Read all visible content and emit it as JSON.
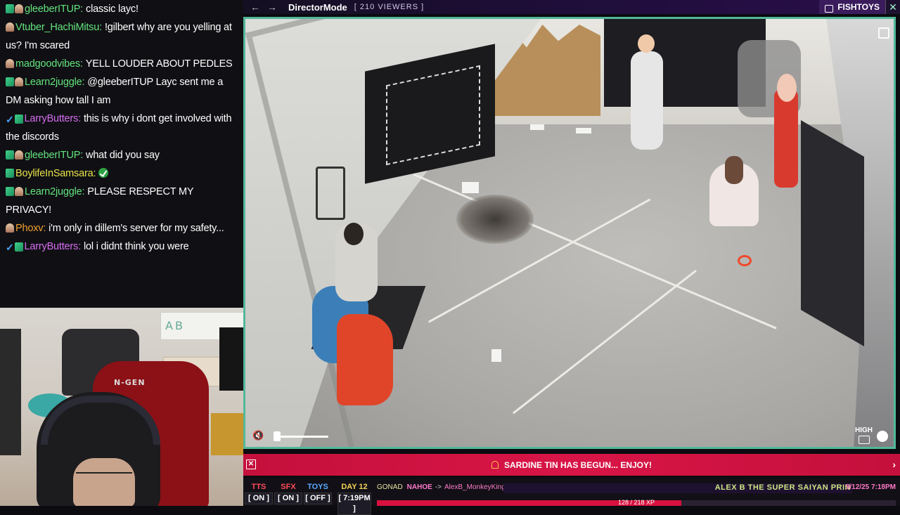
{
  "chat": {
    "messages": [
      {
        "badges": [
          "sub",
          "dad"
        ],
        "user": "gleeberITUP",
        "color": "#63e37d",
        "text": "classic layc!"
      },
      {
        "badges": [
          "dad"
        ],
        "user": "Vtuber_HachiMitsu",
        "color": "#63e37d",
        "text": "!gilbert why are you yelling at us? I'm scared"
      },
      {
        "badges": [
          "dad"
        ],
        "user": "madgoodvibes",
        "color": "#63e37d",
        "text": "YELL LOUDER ABOUT PEDLES"
      },
      {
        "badges": [
          "sub",
          "dad"
        ],
        "user": "Learn2juggle",
        "color": "#63e37d",
        "text": "@gleeberITUP Layc sent me a DM asking how tall I am"
      },
      {
        "badges": [
          "check",
          "sub"
        ],
        "user": "LarryButters",
        "color": "#d66cf0",
        "text": "this is why i dont get involved with the discords"
      },
      {
        "badges": [
          "sub",
          "dad"
        ],
        "user": "gleeberITUP",
        "color": "#63e37d",
        "text": "what did you say"
      },
      {
        "badges": [
          "sub"
        ],
        "user": "BoylifeInSamsara",
        "color": "#e8e24a",
        "text": "",
        "emote": "checkmark-emote"
      },
      {
        "badges": [
          "sub",
          "dad"
        ],
        "user": "Learn2juggle",
        "color": "#63e37d",
        "text": "PLEASE RESPECT MY PRIVACY!"
      },
      {
        "badges": [
          "dad"
        ],
        "user": "Phoxv",
        "color": "#f0a030",
        "text": "i'm only in dillem's server for my safety..."
      },
      {
        "badges": [
          "check",
          "sub"
        ],
        "user": "LarryButters",
        "color": "#d66cf0",
        "text": "lol i didnt think you were"
      }
    ]
  },
  "webcam": {
    "chair_brand": "N-GEN",
    "wall_art_text": "AB"
  },
  "topbar": {
    "back_icon": "←",
    "forward_icon": "→",
    "title": "DirectorMode",
    "viewers": "[ 210 VIEWERS ]",
    "camera_name": "FISHTOYS",
    "close_icon": "✕"
  },
  "player": {
    "quality_label": "HIGH",
    "volume_fraction": 0.08
  },
  "alert": {
    "text": "SARDINE TIN HAS BEGUN... ENJOY!",
    "close_icon": "✕",
    "next_icon": "›"
  },
  "status": {
    "toggles": [
      {
        "label": "TTS",
        "value": "[ ON ]",
        "color": "#ff4a5a"
      },
      {
        "label": "SFX",
        "value": "[ ON ]",
        "color": "#ff4a5a"
      },
      {
        "label": "TOYS",
        "value": "[ OFF ]",
        "color": "#59a8ff"
      },
      {
        "label": "DAY 12",
        "value": "[ 7:19PM ]",
        "color": "#f2d25a"
      }
    ],
    "gonad_cmd": "GONAD",
    "gonad_from": "NAHOE",
    "gonad_arrow": "->",
    "gonad_to": "AlexB_MonkeyKing",
    "ticker": "ALEX B THE SUPER SAIYAN PRIN",
    "clock": "9/12/25 7:18PM",
    "progress_text": "128 / 218 XP",
    "progress_fraction": 0.587
  }
}
